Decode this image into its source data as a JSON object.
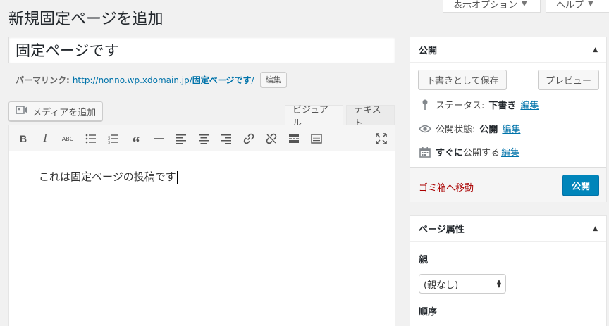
{
  "header": {
    "title": "新規固定ページを追加",
    "screen_options": "表示オプション",
    "help": "ヘルプ"
  },
  "editor": {
    "post_title": "固定ページです",
    "permalink_label": "パーマリンク:",
    "permalink_base": "http://nonno.wp.xdomain.jp/",
    "permalink_slug": "固定ページです",
    "permalink_trailing": "/",
    "edit_slug_button": "編集",
    "add_media": "メディアを追加",
    "tab_visual": "ビジュアル",
    "tab_text": "テキスト",
    "content": "これは固定ページの投稿です",
    "toolbar_icons": [
      "bold-icon",
      "italic-icon",
      "strikethrough-icon",
      "bullet-list-icon",
      "numbered-list-icon",
      "blockquote-icon",
      "horizontal-rule-icon",
      "align-left-icon",
      "align-center-icon",
      "align-right-icon",
      "link-icon",
      "unlink-icon",
      "read-more-icon",
      "toolbar-toggle-icon",
      "fullscreen-icon"
    ]
  },
  "publish_box": {
    "title": "公開",
    "save_draft": "下書きとして保存",
    "preview": "プレビュー",
    "status_label": "ステータス:",
    "status_value": "下書き",
    "visibility_label": "公開状態:",
    "visibility_value": "公開",
    "schedule_label": "すぐに",
    "schedule_suffix": "公開する",
    "edit": "編集",
    "trash": "ゴミ箱へ移動",
    "publish": "公開"
  },
  "attributes_box": {
    "title": "ページ属性",
    "parent_label": "親",
    "parent_value": "(親なし)",
    "order_label": "順序"
  },
  "colors": {
    "primary": "#0085ba",
    "link": "#0073aa",
    "danger": "#a00"
  }
}
